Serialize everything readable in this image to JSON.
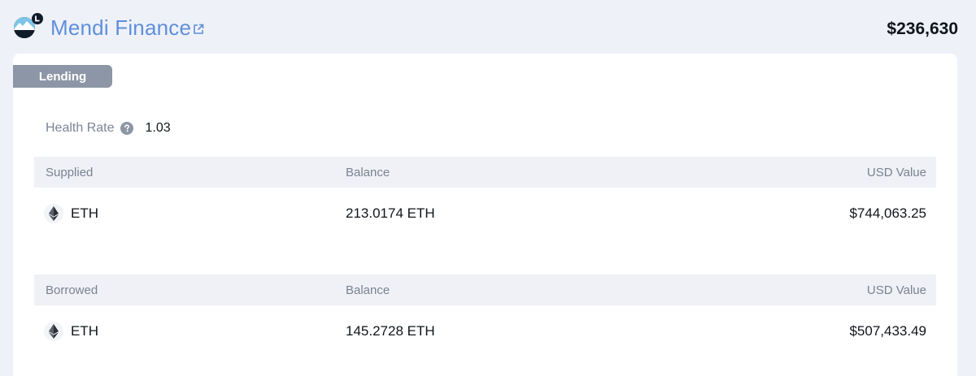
{
  "header": {
    "project_name": "Mendi Finance",
    "total_value": "$236,630",
    "logo_icon": "mendi-logo",
    "external_link_icon": "external-link-icon"
  },
  "card": {
    "tag": "Lending",
    "health": {
      "label": "Health Rate",
      "value": "1.03",
      "help_icon": "question-circle-icon"
    },
    "supplied": {
      "columns": [
        "Supplied",
        "Balance",
        "USD Value"
      ],
      "rows": [
        {
          "token": "ETH",
          "token_icon": "eth-icon",
          "balance": "213.0174 ETH",
          "usd_value": "$744,063.25"
        }
      ]
    },
    "borrowed": {
      "columns": [
        "Borrowed",
        "Balance",
        "USD Value"
      ],
      "rows": [
        {
          "token": "ETH",
          "token_icon": "eth-icon",
          "balance": "145.2728 ETH",
          "usd_value": "$507,433.49"
        }
      ]
    }
  },
  "colors": {
    "background": "#eef1f7",
    "accent_link": "#5f8fdc",
    "tag_bg": "#8c96a6",
    "table_head_bg": "#eff1f6"
  }
}
